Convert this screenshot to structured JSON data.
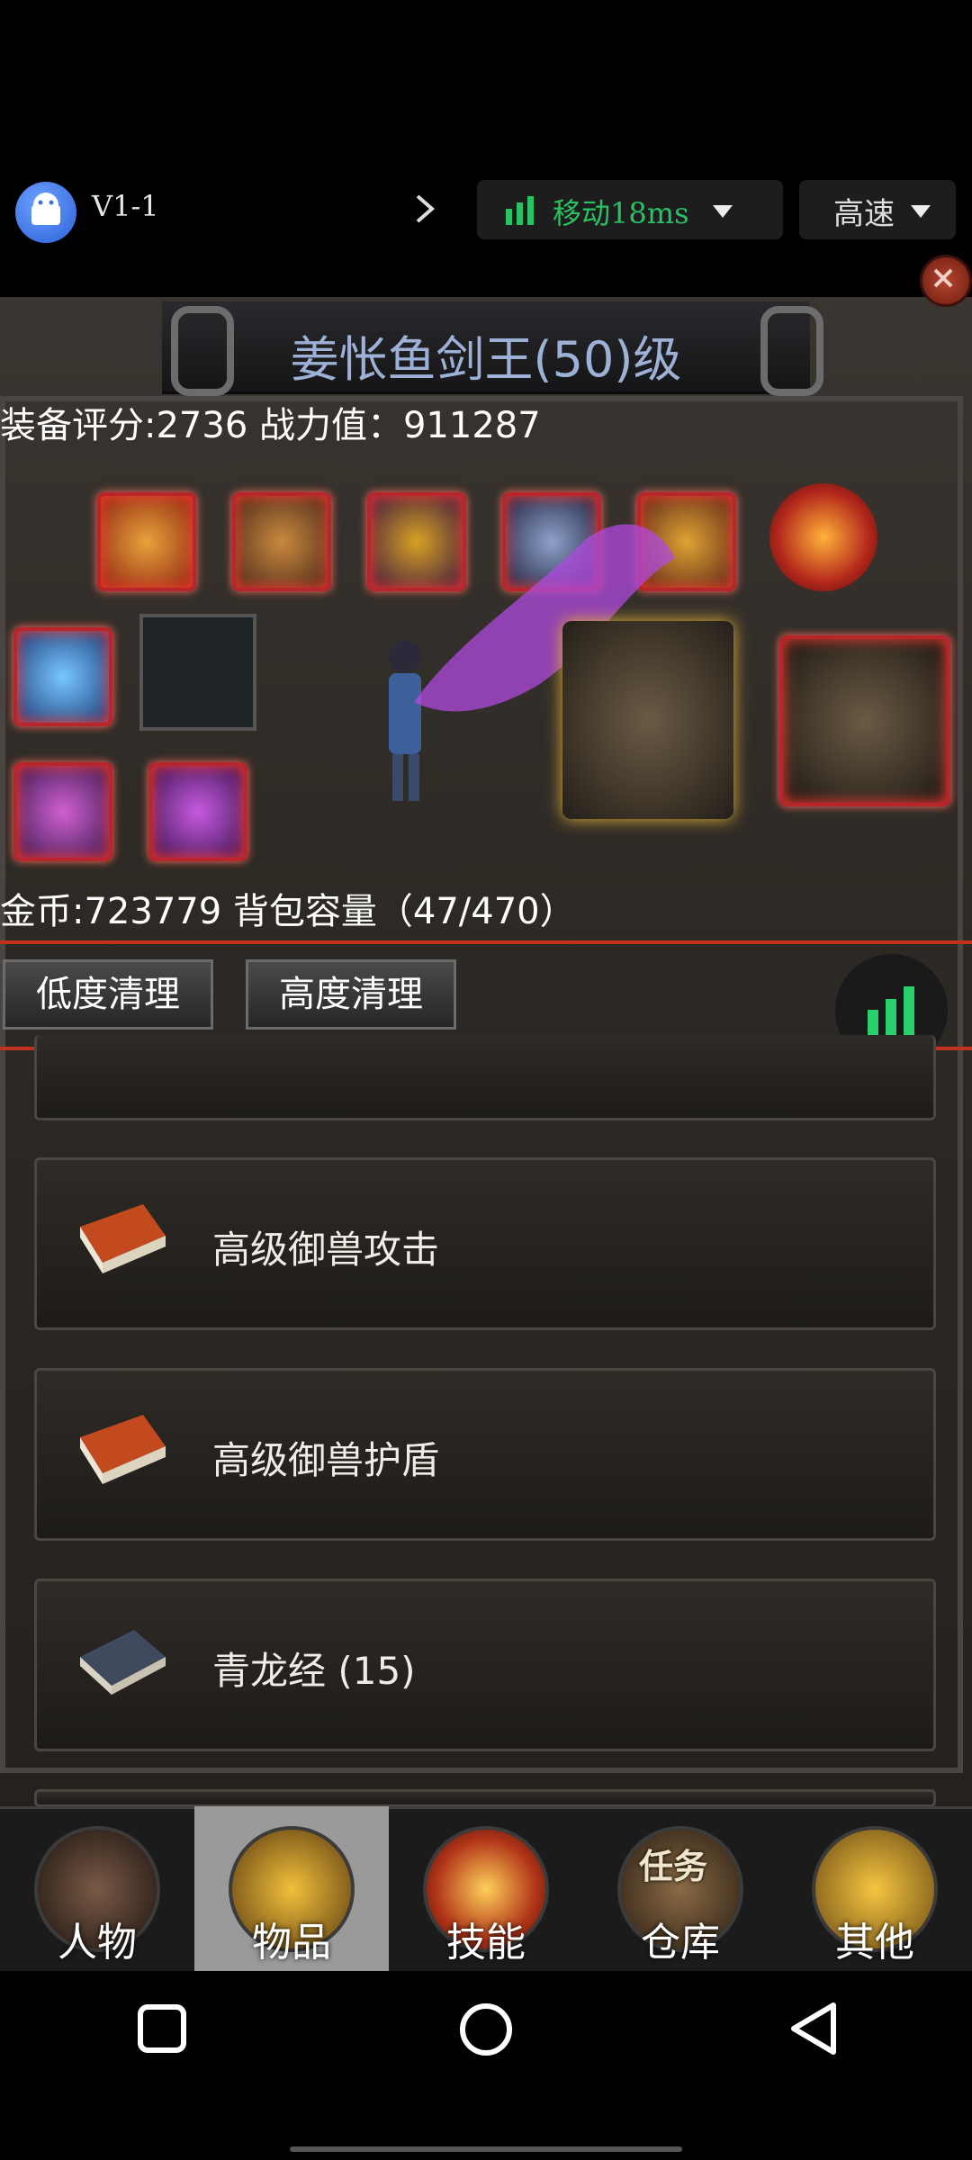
{
  "toolbar": {
    "app_title": "V1-1",
    "network_label": "移动18ms",
    "speed_label": "高速",
    "accent_green": "#29c163"
  },
  "character": {
    "title": "姜怅鱼剑王(50)级",
    "stats": "装备评分:2736 战力值：911287",
    "gold_capacity": "金币:723779 背包容量（47/470）"
  },
  "actions": {
    "low_clean": "低度清理",
    "high_clean": "高度清理"
  },
  "items": [
    {
      "label": "高级御兽攻击",
      "icon": "red-book-icon"
    },
    {
      "label": "高级御兽护盾",
      "icon": "red-book-icon"
    },
    {
      "label": "青龙经 (15)",
      "icon": "blue-book-icon"
    }
  ],
  "nav": [
    {
      "label": "人物"
    },
    {
      "label": "物品"
    },
    {
      "label": "技能"
    },
    {
      "label": "仓库"
    },
    {
      "label": "其他"
    }
  ],
  "nav_badge": "任务"
}
